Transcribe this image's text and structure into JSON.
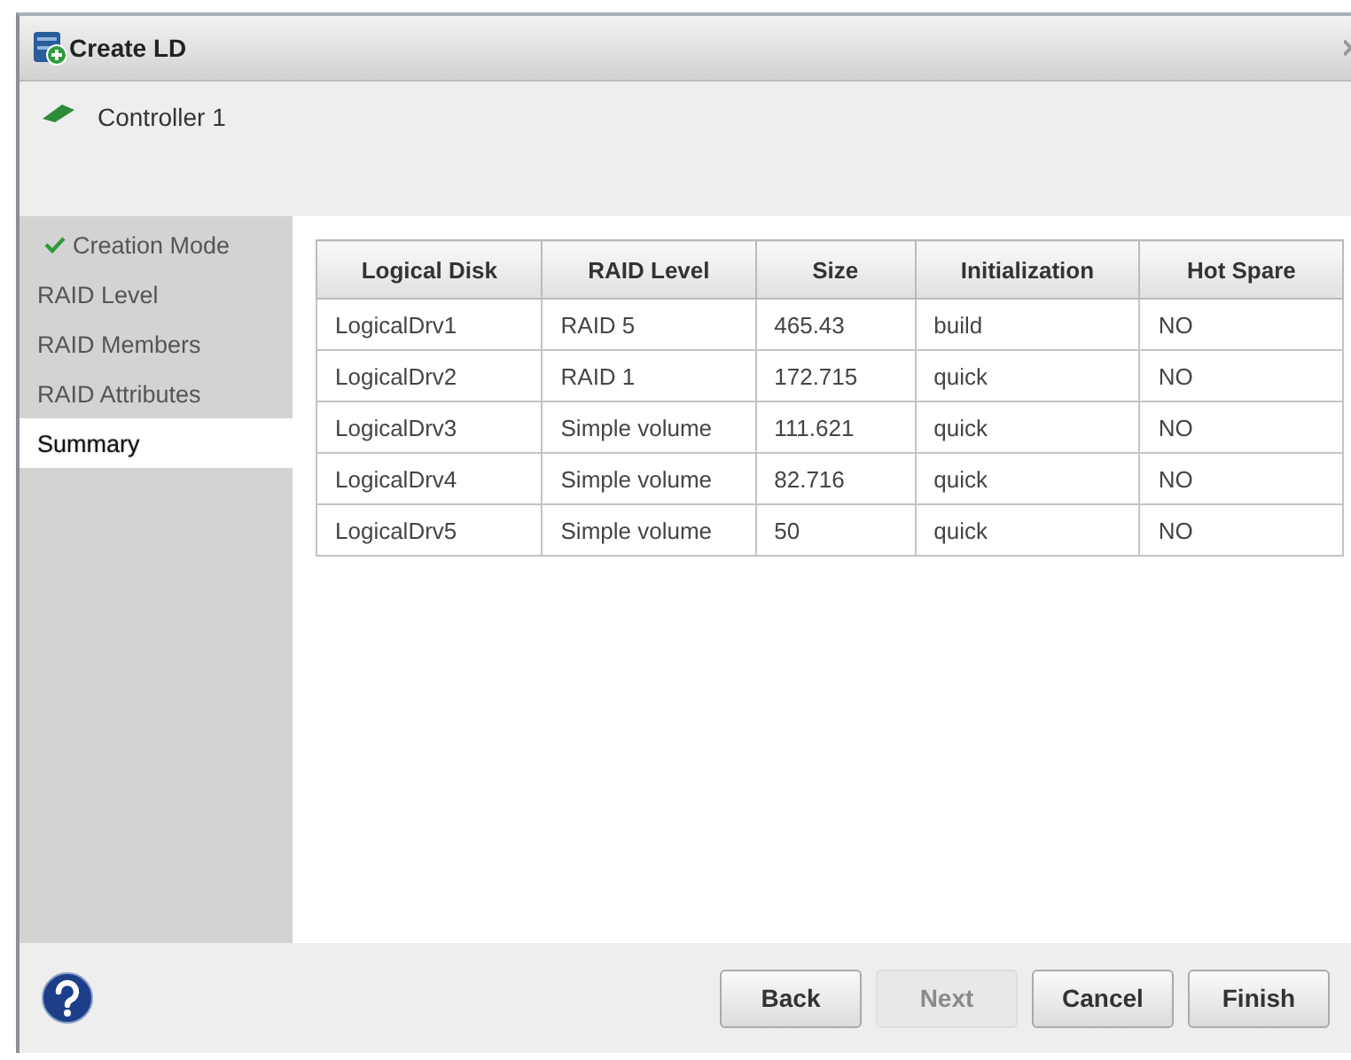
{
  "window": {
    "title": "Create LD"
  },
  "controller": {
    "label": "Controller 1"
  },
  "steps": [
    {
      "label": "Creation Mode",
      "done": true,
      "selected": false
    },
    {
      "label": "RAID Level",
      "done": false,
      "selected": false
    },
    {
      "label": "RAID Members",
      "done": false,
      "selected": false
    },
    {
      "label": "RAID Attributes",
      "done": false,
      "selected": false
    },
    {
      "label": "Summary",
      "done": false,
      "selected": true
    }
  ],
  "table": {
    "columns": [
      "Logical Disk",
      "RAID Level",
      "Size",
      "Initialization",
      "Hot Spare"
    ],
    "rows": [
      [
        "LogicalDrv1",
        "RAID 5",
        "465.43",
        "build",
        "NO"
      ],
      [
        "LogicalDrv2",
        "RAID 1",
        "172.715",
        "quick",
        "NO"
      ],
      [
        "LogicalDrv3",
        "Simple volume",
        "111.621",
        "quick",
        "NO"
      ],
      [
        "LogicalDrv4",
        "Simple volume",
        "82.716",
        "quick",
        "NO"
      ],
      [
        "LogicalDrv5",
        "Simple volume",
        "50",
        "quick",
        "NO"
      ]
    ]
  },
  "buttons": [
    {
      "label": "Back",
      "disabled": false
    },
    {
      "label": "Next",
      "disabled": true
    },
    {
      "label": "Cancel",
      "disabled": false
    },
    {
      "label": "Finish",
      "disabled": false
    }
  ]
}
